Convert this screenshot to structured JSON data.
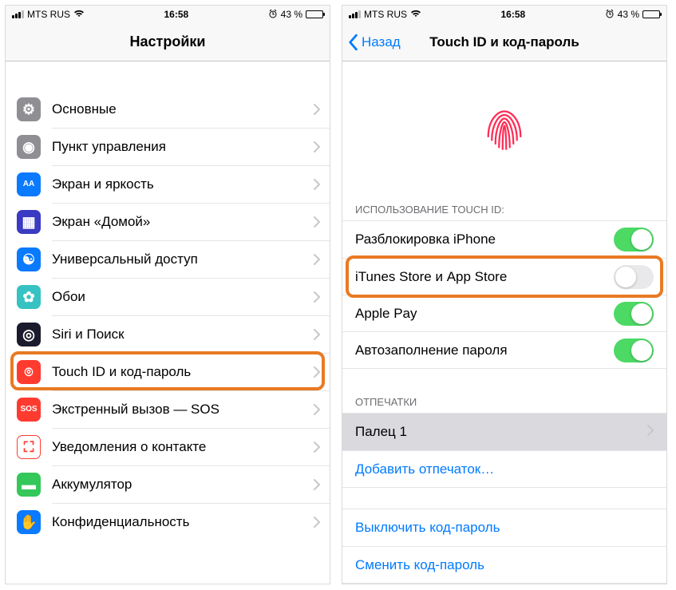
{
  "status": {
    "carrier": "MTS RUS",
    "wifi": "⟡",
    "time": "16:58",
    "alarm": "⏰",
    "battery_pct": "43 %"
  },
  "left": {
    "title": "Настройки",
    "items": [
      {
        "label": "Основные",
        "icon_bg": "#8e8e93",
        "glyph": "⚙"
      },
      {
        "label": "Пункт управления",
        "icon_bg": "#8e8e93",
        "glyph": "◉"
      },
      {
        "label": "Экран и яркость",
        "icon_bg": "#0a7aff",
        "glyph": "AA"
      },
      {
        "label": "Экран «Домой»",
        "icon_bg": "#3a3ac2",
        "glyph": "▦"
      },
      {
        "label": "Универсальный доступ",
        "icon_bg": "#0a7aff",
        "glyph": "☯"
      },
      {
        "label": "Обои",
        "icon_bg": "#36c2c2",
        "glyph": "✿"
      },
      {
        "label": "Siri и Поиск",
        "icon_bg": "#1b1b2e",
        "glyph": "◎"
      },
      {
        "label": "Touch ID и код-пароль",
        "icon_bg": "#ff3b30",
        "glyph": "⌾"
      },
      {
        "label": "Экстренный вызов — SOS",
        "icon_bg": "#ff3b30",
        "glyph": "SOS"
      },
      {
        "label": "Уведомления о контакте",
        "icon_bg": "#ffffff",
        "glyph": "⛶"
      },
      {
        "label": "Аккумулятор",
        "icon_bg": "#34c759",
        "glyph": "▬"
      },
      {
        "label": "Конфиденциальность",
        "icon_bg": "#0a7aff",
        "glyph": "✋"
      }
    ],
    "highlight_index": 7
  },
  "right": {
    "back": "Назад",
    "title": "Touch ID и код-пароль",
    "usage_header": "ИСПОЛЬЗОВАНИЕ TOUCH ID:",
    "toggles": [
      {
        "label": "Разблокировка iPhone",
        "on": true
      },
      {
        "label": "iTunes Store и App Store",
        "on": false
      },
      {
        "label": "Apple Pay",
        "on": true
      },
      {
        "label": "Автозаполнение пароля",
        "on": true
      }
    ],
    "highlight_toggle_index": 1,
    "fingerprints_header": "ОТПЕЧАТКИ",
    "finger_row": "Палец 1",
    "add_fingerprint": "Добавить отпечаток…",
    "actions": [
      "Выключить код-пароль",
      "Сменить код-пароль"
    ]
  }
}
